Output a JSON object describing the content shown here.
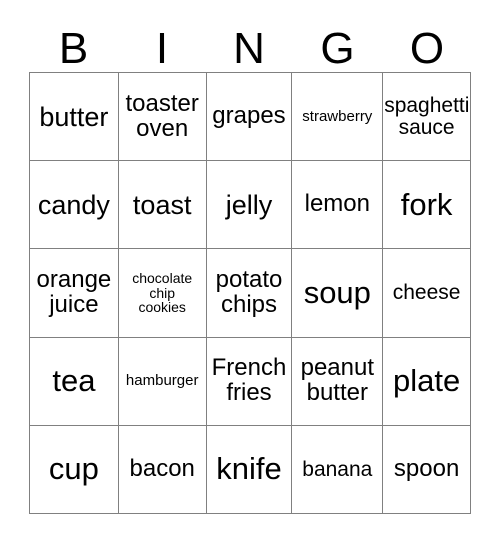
{
  "card": {
    "title": "BINGO",
    "header_letters": [
      "B",
      "I",
      "N",
      "G",
      "O"
    ],
    "rows": [
      [
        {
          "text": "butter",
          "size": "fs-lg"
        },
        {
          "text": "toaster\noven",
          "size": "fs-md"
        },
        {
          "text": "grapes",
          "size": "fs-md"
        },
        {
          "text": "strawberry",
          "size": "fs-xs"
        },
        {
          "text": "spaghetti\nsauce",
          "size": "fs-sm"
        }
      ],
      [
        {
          "text": "candy",
          "size": "fs-lg"
        },
        {
          "text": "toast",
          "size": "fs-lg"
        },
        {
          "text": "jelly",
          "size": "fs-lg"
        },
        {
          "text": "lemon",
          "size": "fs-md"
        },
        {
          "text": "fork",
          "size": "fs-xl"
        }
      ],
      [
        {
          "text": "orange\njuice",
          "size": "fs-md"
        },
        {
          "text": "chocolate\nchip\ncookies",
          "size": "fs-xxs"
        },
        {
          "text": "potato\nchips",
          "size": "fs-md"
        },
        {
          "text": "soup",
          "size": "fs-xl"
        },
        {
          "text": "cheese",
          "size": "fs-sm"
        }
      ],
      [
        {
          "text": "tea",
          "size": "fs-xl"
        },
        {
          "text": "hamburger",
          "size": "fs-xs"
        },
        {
          "text": "French\nfries",
          "size": "fs-md"
        },
        {
          "text": "peanut\nbutter",
          "size": "fs-md"
        },
        {
          "text": "plate",
          "size": "fs-xl"
        }
      ],
      [
        {
          "text": "cup",
          "size": "fs-xl"
        },
        {
          "text": "bacon",
          "size": "fs-md"
        },
        {
          "text": "knife",
          "size": "fs-xl"
        },
        {
          "text": "banana",
          "size": "fs-sm"
        },
        {
          "text": "spoon",
          "size": "fs-md"
        }
      ]
    ]
  },
  "colors": {
    "background": "#ffffff",
    "text": "#000000",
    "grid_line": "#808080"
  }
}
